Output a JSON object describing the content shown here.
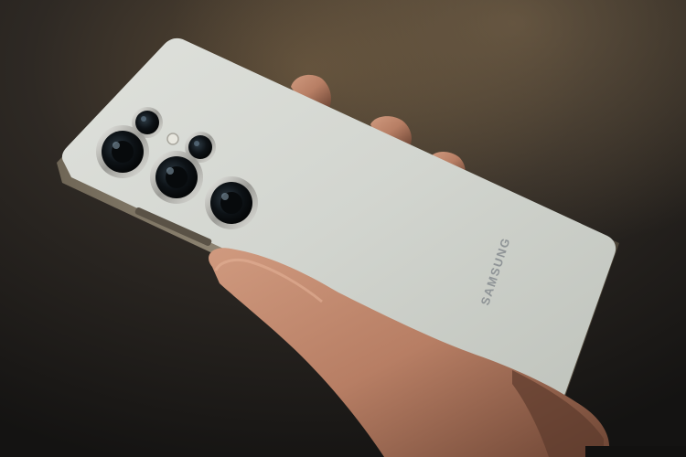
{
  "photo": {
    "subject": "smartphone-rear-held-in-hand",
    "brand_text": "SAMSUNG",
    "colors": {
      "background_dark": "#1b1a18",
      "background_warm": "#5a4a36",
      "phone_back": "#d3d6d0",
      "phone_frame": "#8d8474",
      "lens_dark": "#0d1216",
      "lens_ring": "#c9c9c4",
      "skin": "#c08a70",
      "skin_shadow": "#6d4534"
    }
  }
}
